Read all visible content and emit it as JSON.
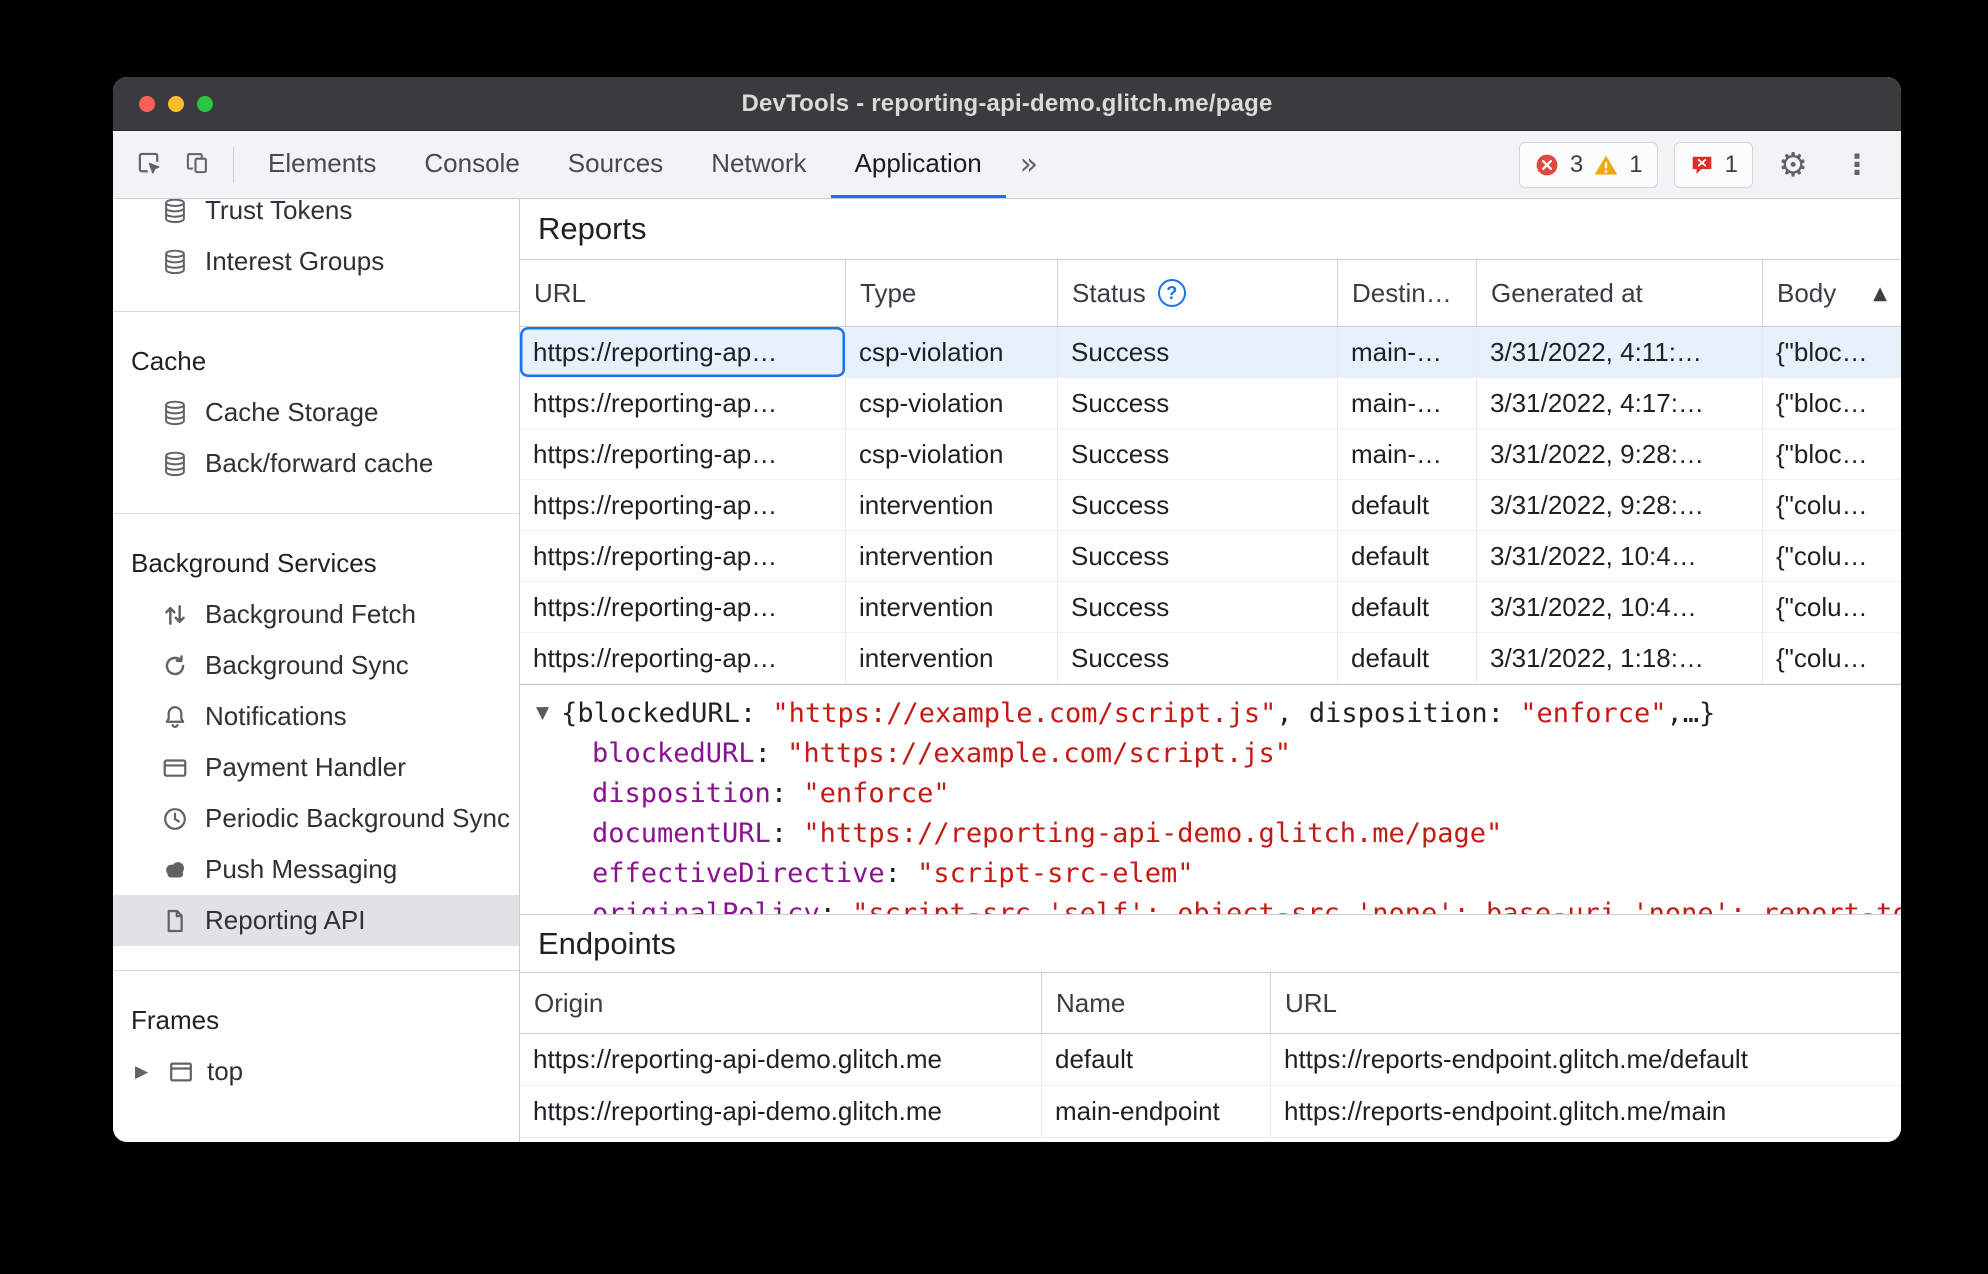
{
  "window": {
    "title": "DevTools - reporting-api-demo.glitch.me/page"
  },
  "toolbar": {
    "tabs": [
      "Elements",
      "Console",
      "Sources",
      "Network",
      "Application"
    ],
    "selected_tab": "Application",
    "error_count": "3",
    "warning_count": "1",
    "issues_count": "1"
  },
  "icons": {
    "gear": "⚙",
    "kebab": "⋮",
    "more_tabs": "»",
    "sort_ascending": "▲",
    "caret_collapsed": "▶",
    "caret_expanded": "▼",
    "status_help": "?"
  },
  "sidebar": {
    "sections": [
      {
        "items": [
          {
            "icon": "database",
            "label": "Trust Tokens",
            "clipped": true
          },
          {
            "icon": "database",
            "label": "Interest Groups"
          }
        ]
      },
      {
        "header": "Cache",
        "items": [
          {
            "icon": "database",
            "label": "Cache Storage"
          },
          {
            "icon": "database",
            "label": "Back/forward cache"
          }
        ]
      },
      {
        "header": "Background Services",
        "items": [
          {
            "icon": "fetch",
            "label": "Background Fetch"
          },
          {
            "icon": "sync",
            "label": "Background Sync"
          },
          {
            "icon": "bell",
            "label": "Notifications"
          },
          {
            "icon": "card",
            "label": "Payment Handler"
          },
          {
            "icon": "clock",
            "label": "Periodic Background Sync"
          },
          {
            "icon": "cloud",
            "label": "Push Messaging"
          },
          {
            "icon": "file",
            "label": "Reporting API",
            "selected": true
          }
        ]
      },
      {
        "header": "Frames",
        "items": [
          {
            "icon": "frame",
            "label": "top",
            "caret": true
          }
        ]
      }
    ]
  },
  "reports": {
    "title": "Reports",
    "columns": [
      {
        "label": "URL"
      },
      {
        "label": "Type"
      },
      {
        "label": "Status",
        "help": true
      },
      {
        "label": "Destin…"
      },
      {
        "label": "Generated at"
      },
      {
        "label": "Body",
        "sort": "asc"
      }
    ],
    "rows": [
      {
        "url": "https://reporting-ap…",
        "type": "csp-violation",
        "status": "Success",
        "destination": "main-…",
        "generated_at": "3/31/2022, 4:11:…",
        "body": "{\"bloc…",
        "selected": true
      },
      {
        "url": "https://reporting-ap…",
        "type": "csp-violation",
        "status": "Success",
        "destination": "main-…",
        "generated_at": "3/31/2022, 4:17:…",
        "body": "{\"bloc…"
      },
      {
        "url": "https://reporting-ap…",
        "type": "csp-violation",
        "status": "Success",
        "destination": "main-…",
        "generated_at": "3/31/2022, 9:28:…",
        "body": "{\"bloc…"
      },
      {
        "url": "https://reporting-ap…",
        "type": "intervention",
        "status": "Success",
        "destination": "default",
        "generated_at": "3/31/2022, 9:28:…",
        "body": "{\"colu…"
      },
      {
        "url": "https://reporting-ap…",
        "type": "intervention",
        "status": "Success",
        "destination": "default",
        "generated_at": "3/31/2022, 10:4…",
        "body": "{\"colu…"
      },
      {
        "url": "https://reporting-ap…",
        "type": "intervention",
        "status": "Success",
        "destination": "default",
        "generated_at": "3/31/2022, 10:4…",
        "body": "{\"colu…"
      },
      {
        "url": "https://reporting-ap…",
        "type": "intervention",
        "status": "Success",
        "destination": "default",
        "generated_at": "3/31/2022, 1:18:…",
        "body": "{\"colu…"
      }
    ]
  },
  "preview": {
    "summary_parts": [
      {
        "t": "plain",
        "v": "{"
      },
      {
        "t": "plain",
        "v": "blockedURL"
      },
      {
        "t": "plain",
        "v": ": "
      },
      {
        "t": "str",
        "v": "\"https://example.com/script.js\""
      },
      {
        "t": "plain",
        "v": ", "
      },
      {
        "t": "plain",
        "v": "disposition"
      },
      {
        "t": "plain",
        "v": ": "
      },
      {
        "t": "str",
        "v": "\"enforce\""
      },
      {
        "t": "plain",
        "v": ",…}"
      }
    ],
    "properties": [
      {
        "key": "blockedURL",
        "value": "\"https://example.com/script.js\""
      },
      {
        "key": "disposition",
        "value": "\"enforce\""
      },
      {
        "key": "documentURL",
        "value": "\"https://reporting-api-demo.glitch.me/page\""
      },
      {
        "key": "effectiveDirective",
        "value": "\"script-src-elem\""
      },
      {
        "key": "originalPolicy",
        "value": "\"script-src 'self'; object-src 'none'; base-uri 'none'; report-to main-endpoint\"",
        "clipped": true
      }
    ]
  },
  "endpoints": {
    "title": "Endpoints",
    "columns": [
      "Origin",
      "Name",
      "URL"
    ],
    "rows": [
      {
        "origin": "https://reporting-api-demo.glitch.me",
        "name": "default",
        "url": "https://reports-endpoint.glitch.me/default"
      },
      {
        "origin": "https://reporting-api-demo.glitch.me",
        "name": "main-endpoint",
        "url": "https://reports-endpoint.glitch.me/main"
      }
    ]
  },
  "colors": {
    "accent": "#1a73e8",
    "error": "#df4940",
    "warning": "#f2a60d",
    "selected_row": "#e7f0fd",
    "selected_sidebar_item": "#e0e2e6",
    "json_key": "#881391",
    "json_string": "#c41a16"
  }
}
